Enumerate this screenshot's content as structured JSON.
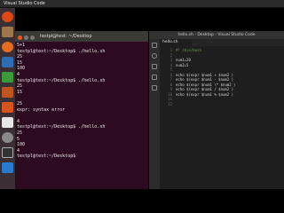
{
  "topbar": {
    "title": "Visual Studio Code"
  },
  "terminal": {
    "title": "testpl@test: ~/Desktop",
    "lines": [
      "5+1",
      "testpl@test:~/Desktop$ ./hello.sh",
      "25",
      "15",
      "100",
      "4",
      "testpl@test:~/Desktop$ ./hello.sh",
      "25",
      "15",
      "",
      "25",
      "expr: syntax error",
      "",
      "4",
      "testpl@test:~/Desktop$ ./hello.sh",
      "25",
      "5",
      "100",
      "4",
      "testpl@test:~/Desktop$ "
    ]
  },
  "vscode": {
    "title": "hello.sh - Desktop - Visual Studio Code",
    "tab": "hello.sh",
    "line_numbers": "1\n2\n3\n4\n5\n6\n7\n8\n9\n10\n11\n12",
    "code": [
      {
        "t": "#! /bin/bash",
        "c": "cmt"
      },
      {
        "t": "",
        "c": ""
      },
      {
        "t": "num1=20",
        "c": ""
      },
      {
        "t": "num2=5",
        "c": ""
      },
      {
        "t": "",
        "c": ""
      },
      {
        "t": "echo $(expr $num1 + $num2 )",
        "c": ""
      },
      {
        "t": "echo $(expr $num1 - $num2 )",
        "c": ""
      },
      {
        "t": "echo $(expr $num1 \\* $num2 )",
        "c": ""
      },
      {
        "t": "echo $(expr $num1 / $num2 )",
        "c": ""
      },
      {
        "t": "echo $(expr $num1 % $num2 )",
        "c": ""
      }
    ]
  },
  "colors": {
    "terminal_bg": "#2c0a1f",
    "editor_bg": "#1e1e1e",
    "launcher_bg": "#3a2f35"
  },
  "launcher_icons": [
    "ubuntu-icon",
    "files-icon",
    "firefox-icon",
    "libreoffice-writer-icon",
    "libreoffice-calc-icon",
    "libreoffice-impress-icon",
    "software-center-icon",
    "amazon-icon",
    "settings-icon",
    "terminal-icon",
    "vscode-icon",
    "trash-icon"
  ]
}
